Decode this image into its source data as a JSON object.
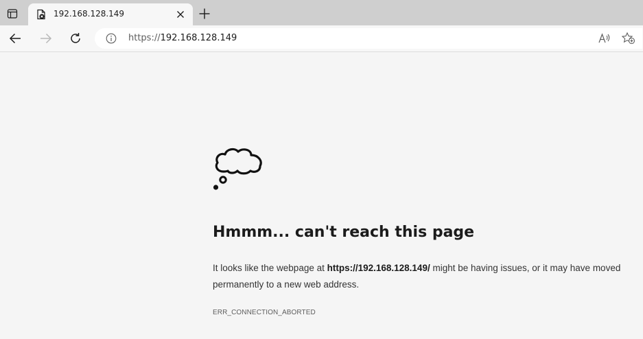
{
  "browser": {
    "tab": {
      "title": "192.168.128.149",
      "close_icon": "close-icon",
      "favicon": "document-error-icon"
    },
    "newtab_icon": "plus-icon",
    "tab_actions_icon": "tab-actions-icon",
    "nav": {
      "back_icon": "arrow-left-icon",
      "forward_icon": "arrow-right-icon",
      "refresh_icon": "refresh-icon"
    },
    "address": {
      "scheme": "https://",
      "host": "192.168.128.149",
      "info_icon": "info-icon",
      "read_aloud_icon": "read-aloud-icon",
      "favorites_icon": "add-favorite-icon"
    }
  },
  "error_page": {
    "illustration": "thought-cloud-icon",
    "heading": "Hmmm... can't reach this page",
    "message_prefix": "It looks like the webpage at ",
    "message_url": "https://192.168.128.149/",
    "message_suffix": " might be having issues, or it may have moved permanently to a new web address.",
    "error_code": "ERR_CONNECTION_ABORTED"
  }
}
